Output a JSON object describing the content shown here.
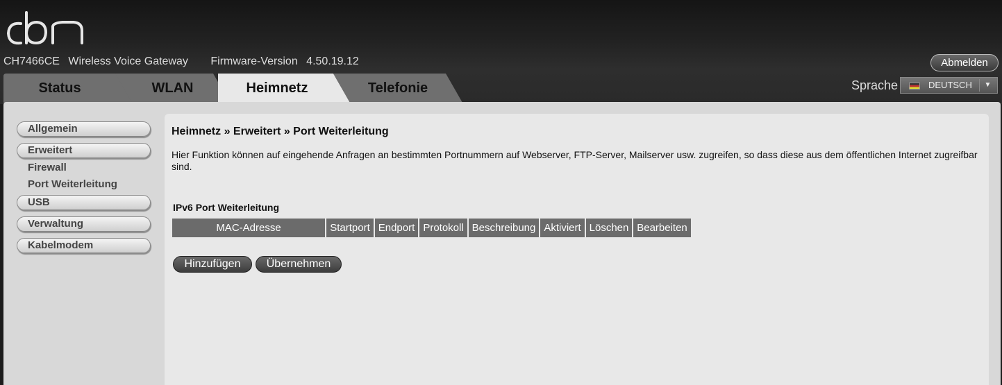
{
  "header": {
    "logo_text": "cbn",
    "model": "CH7466CE",
    "product": "Wireless Voice Gateway",
    "firmware_label": "Firmware-Version",
    "firmware_version": "4.50.19.12",
    "logout_label": "Abmelden"
  },
  "tabs": [
    {
      "label": "Status",
      "active": false
    },
    {
      "label": "WLAN",
      "active": false
    },
    {
      "label": "Heimnetz",
      "active": true
    },
    {
      "label": "Telefonie",
      "active": false
    }
  ],
  "language": {
    "label": "Sprache",
    "selected": "DEUTSCH"
  },
  "sidebar": {
    "items": [
      {
        "label": "Allgemein"
      },
      {
        "label": "Erweitert"
      },
      {
        "label": "Firewall"
      },
      {
        "label": "Port Weiterleitung"
      },
      {
        "label": "USB"
      },
      {
        "label": "Verwaltung"
      },
      {
        "label": "Kabelmodem"
      }
    ]
  },
  "main": {
    "breadcrumb": "Heimnetz » Erweitert » Port Weiterleitung",
    "description": "Hier Funktion können auf eingehende Anfragen an bestimmten Portnummern auf Webserver, FTP-Server, Mailserver usw. zugreifen, so dass diese aus dem öffentlichen Internet zugreifbar sind.",
    "section_title": "IPv6 Port Weiterleitung",
    "table_headers": [
      "MAC-Adresse",
      "Startport",
      "Endport",
      "Protokoll",
      "Beschreibung",
      "Aktiviert",
      "Löschen",
      "Bearbeiten"
    ],
    "add_label": "Hinzufügen",
    "apply_label": "Übernehmen"
  },
  "colors": {
    "header_bg": "#1c1c1c",
    "tab_inactive": "#6f6f6f",
    "tab_active": "#e8e8e8",
    "table_header": "#6b6b6b",
    "panel_bg": "#e8e8e8"
  }
}
